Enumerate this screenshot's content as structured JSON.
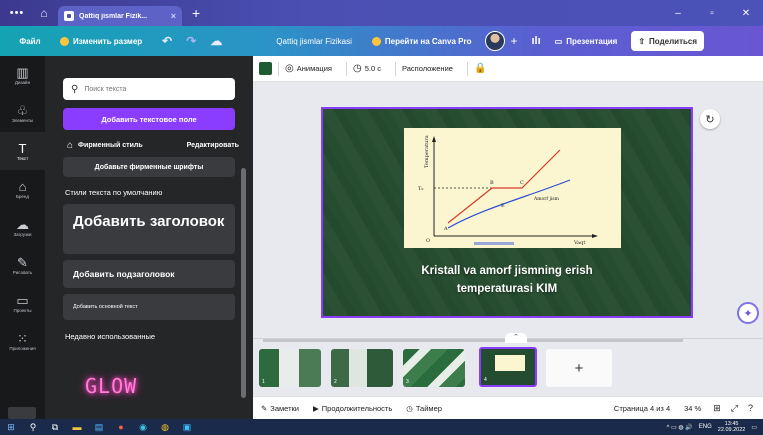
{
  "browser": {
    "tab_title": "Qattiq jismlar Fizik...",
    "tab_close": "×",
    "new_tab": "+",
    "menu_dots": "•••",
    "home_icon": "home-icon",
    "window_buttons": [
      "–",
      "▫",
      "✕"
    ]
  },
  "topbar": {
    "file_label": "Файл",
    "resize_label": "Изменить размер",
    "undo": "↶",
    "redo": "↷",
    "cloud": "☁",
    "doc_name": "Qattiq jismlar Fizikasi",
    "pro_label": "Перейти на Canva Pro",
    "plus": "+",
    "stats_icon": "ılı",
    "present_label": "Презентация",
    "present_icon": "▭",
    "share_label": "Поделиться",
    "share_icon": "⇧"
  },
  "rail": {
    "items": [
      {
        "label": "Дизайн",
        "icon": "▥"
      },
      {
        "label": "Элементы",
        "icon": "♧"
      },
      {
        "label": "Текст",
        "icon": "T"
      },
      {
        "label": "Бренд",
        "icon": "⌂"
      },
      {
        "label": "Загрузки",
        "icon": "☁"
      },
      {
        "label": "Рисовать",
        "icon": "✎"
      },
      {
        "label": "Проекты",
        "icon": "▭"
      },
      {
        "label": "Приложения",
        "icon": "⁙"
      }
    ]
  },
  "panel": {
    "search_placeholder": "Поиск текста",
    "search_icon": "⚲",
    "add_textbox": "Добавить текстовое поле",
    "brand_style": "Фирменный стиль",
    "brand_icon": "⌂",
    "edit": "Редактировать",
    "add_brand_fonts": "Добавьте фирменные шрифты",
    "default_styles": "Стили текста по умолчанию",
    "heading": "Добавить заголовок",
    "subheading": "Добавить подзаголовок",
    "body_text": "Добавить основной текст",
    "recently_used": "Недавно использованные",
    "glow_sample": "GLOW",
    "collapse": "‹"
  },
  "editor_toolbar": {
    "animation": "Анимация",
    "animation_icon": "◎",
    "duration": "5.0 с",
    "duration_icon": "◷",
    "position": "Расположение",
    "lock_icon": "🔒",
    "color_swatch": "#1f5a30"
  },
  "slide": {
    "title_line1": "Kristall va amorf jismning erish",
    "title_line2": "temperaturasi KIM",
    "refresh_icon": "↻",
    "magic_icon": "✦",
    "graph": {
      "ylabel": "Temperatura",
      "xlabel": "Vaqt",
      "t0_label": "T₀",
      "points": {
        "A": "A",
        "B": "B",
        "C": "C",
        "D": "D",
        "E": "E",
        "O": "O"
      },
      "amorf_label": "Amorf jism"
    }
  },
  "strip": {
    "handle": "⌃",
    "thumbs": [
      {
        "num": "1",
        "title": "QATTIQ JISMLAR"
      },
      {
        "num": "2",
        "title": ""
      },
      {
        "num": "3",
        "title": ""
      },
      {
        "num": "4",
        "title": ""
      }
    ],
    "add_page": "+"
  },
  "footer": {
    "notes": "Заметки",
    "notes_icon": "✎",
    "duration": "Продолжительность",
    "duration_icon": "▶",
    "timer": "Таймер",
    "timer_icon": "◷",
    "page": "Страница 4 из 4",
    "zoom": "34 %",
    "grid_icon": "⊞",
    "expand_icon": "⤢",
    "help_icon": "?"
  },
  "taskbar": {
    "lang": "ENG",
    "time": "13:45",
    "date": "22.09.2022",
    "tray_icons": "^ ▭ ◍ 🔊"
  }
}
